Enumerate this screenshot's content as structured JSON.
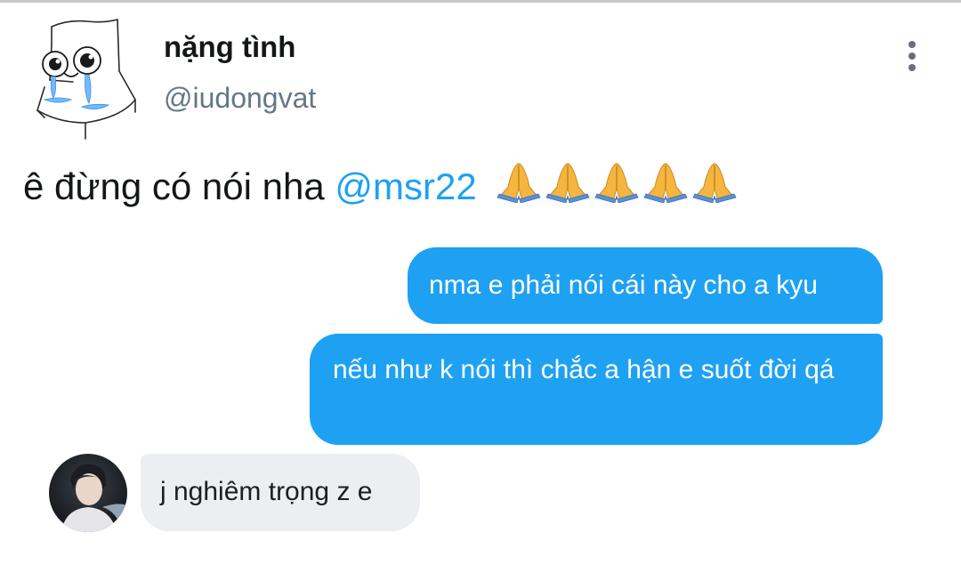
{
  "tweet": {
    "display_name": "nặng tình",
    "handle": "@iudongvat",
    "text_prefix": "ê đừng có nói nha ",
    "mention": "@msr22",
    "emoji_count": 5
  },
  "conversation": {
    "sent_messages": [
      "nma e phải nói cái này cho a kyu",
      "nếu như k nói thì chắc a hận e suốt đời qá"
    ],
    "received_message": "j nghiêm trọng z e"
  },
  "colors": {
    "accent": "#1da1f2",
    "sent_bubble": "#1ea1f2",
    "received_bubble": "#eceef1",
    "handle_gray": "#657786"
  },
  "icons": {
    "more": "vertical-ellipsis-icon",
    "emoji": "folded-hands-icon"
  }
}
